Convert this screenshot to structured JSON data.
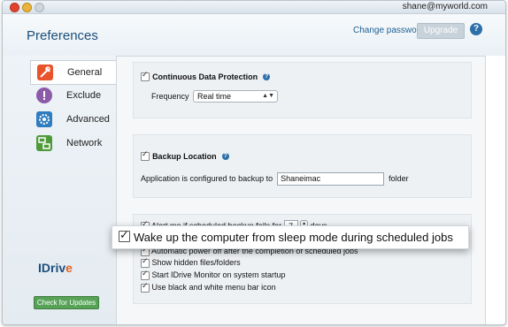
{
  "titlebar": {
    "user_email": "shane@myworld.com"
  },
  "header": {
    "title": "Preferences",
    "change_password": "Change password",
    "upgrade": "Upgrade",
    "help": "?"
  },
  "sidebar": {
    "items": [
      {
        "label": "General",
        "icon": "wrench-icon",
        "active": true
      },
      {
        "label": "Exclude",
        "icon": "exclude-icon"
      },
      {
        "label": "Advanced",
        "icon": "gear-icon"
      },
      {
        "label": "Network",
        "icon": "network-icon"
      }
    ],
    "logo_main": "IDriv",
    "logo_e": "e",
    "check_updates": "Check for Updates"
  },
  "cdp": {
    "label": "Continuous Data Protection",
    "frequency_label": "Frequency",
    "frequency_value": "Real time",
    "help": "?"
  },
  "backup_location": {
    "label": "Backup Location",
    "help": "?",
    "configured_text": "Application is configured to backup to",
    "value": "Shaneimac",
    "suffix": "folder"
  },
  "options": {
    "alert_text": "Alert me if scheduled backup fails for",
    "alert_days": "7",
    "alert_suffix": "days",
    "items": [
      "Wake up the computer from sleep mode during scheduled jobs",
      "Automatic power off after the completion of scheduled jobs",
      "Show hidden files/folders",
      "Start IDrive Monitor on system startup",
      "Use black and white menu bar icon"
    ]
  },
  "colors": {
    "accent": "#1d5f92",
    "check_updates": "#57a257"
  }
}
